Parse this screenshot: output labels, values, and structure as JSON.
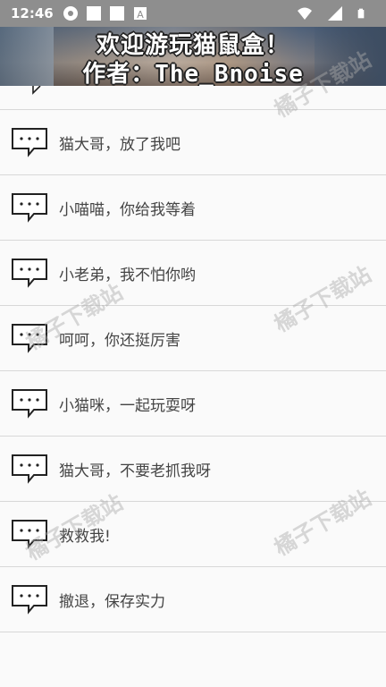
{
  "status_bar": {
    "time": "12:46",
    "icons": [
      "shield-icon",
      "square-icon",
      "square-icon",
      "a-icon"
    ],
    "right_icons": [
      "wifi-icon",
      "signal-icon",
      "battery-icon"
    ]
  },
  "banner": {
    "line1": "欢迎游玩猫鼠盒！",
    "line2": "作者：The_Bnoise"
  },
  "items": [
    {
      "label": "猫大哥，放了我吧"
    },
    {
      "label": "小喵喵，你给我等着"
    },
    {
      "label": "小老弟，我不怕你哟"
    },
    {
      "label": "呵呵，你还挺厉害"
    },
    {
      "label": "小猫咪，一起玩耍呀"
    },
    {
      "label": "猫大哥，不要老抓我呀"
    },
    {
      "label": "救救我!"
    },
    {
      "label": "撤退，保存实力"
    }
  ],
  "watermark": "橘子下载站"
}
